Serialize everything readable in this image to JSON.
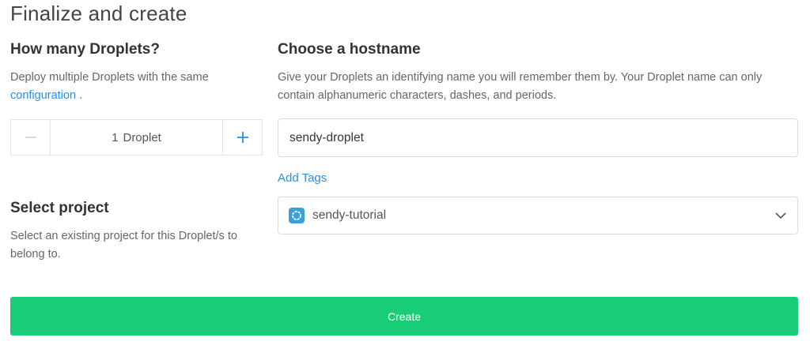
{
  "page": {
    "title": "Finalize and create"
  },
  "droplets": {
    "heading": "How many Droplets?",
    "description": "Deploy multiple Droplets with the same",
    "link_text": "configuration",
    "trailing": ".",
    "stepper": {
      "count": "1",
      "unit": "Droplet",
      "minus_icon": "minus-icon",
      "plus_icon": "plus-icon"
    }
  },
  "hostname": {
    "heading": "Choose a hostname",
    "description": "Give your Droplets an identifying name you will remember them by. Your Droplet name can only contain alphanumeric characters, dashes, and periods.",
    "value": "sendy-droplet",
    "add_tags_label": "Add Tags"
  },
  "project": {
    "heading": "Select project",
    "description": "Select an existing project for this Droplet/s to belong to.",
    "selected": "sendy-tutorial",
    "icon": "project-icon",
    "chevron": "chevron-down-icon"
  },
  "actions": {
    "create_label": "Create"
  },
  "colors": {
    "accent_link": "#2a8fe0",
    "create_button": "#19cc77",
    "project_icon": "#3aa0d8"
  }
}
